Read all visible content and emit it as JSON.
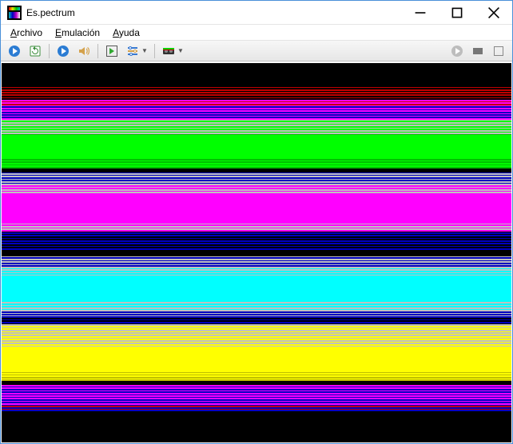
{
  "window": {
    "title": "Es.pectrum"
  },
  "menu": {
    "items": [
      {
        "accel": "A",
        "rest": "rchivo"
      },
      {
        "accel": "E",
        "rest": "mulación"
      },
      {
        "accel": "A",
        "rest": "yuda"
      }
    ]
  },
  "toolbar": {
    "icons_left": [
      "play-icon",
      "refresh-icon",
      "sep",
      "run-icon",
      "sound-icon",
      "sep",
      "step-icon",
      "config-icon",
      "sep",
      "tape-icon"
    ],
    "icons_right": [
      "record-icon",
      "screen-icon",
      "snapshot-icon"
    ]
  },
  "spectrum_colors": {
    "K": "#000000",
    "R": "#c00000",
    "B": "#0000c0",
    "M": "#c000c0",
    "G": "#00c000",
    "C": "#00c0c0",
    "Y": "#c0c000",
    "W": "#c0c0c0",
    "r": "#ff0000",
    "b": "#0000ff",
    "m": "#ff00ff",
    "g": "#00ff00",
    "c": "#00ffff",
    "y": "#ffff00",
    "w": "#ffffff"
  },
  "stripes": [
    "K",
    "K",
    "K",
    "K",
    "K",
    "K",
    "K",
    "K",
    "K",
    "K",
    "K",
    "K",
    "K",
    "K",
    "K",
    "K",
    "K",
    "K",
    "R",
    "K",
    "R",
    "K",
    "R",
    "K",
    "R",
    "K",
    "R",
    "K",
    "m",
    "R",
    "m",
    "R",
    "m",
    "B",
    "m",
    "B",
    "m",
    "B",
    "m",
    "B",
    "m",
    "B",
    "m",
    "W",
    "g",
    "W",
    "g",
    "W",
    "g",
    "W",
    "g",
    "W",
    "g",
    "W",
    "G",
    "g",
    "g",
    "g",
    "g",
    "g",
    "g",
    "g",
    "g",
    "g",
    "g",
    "g",
    "g",
    "g",
    "g",
    "g",
    "g",
    "g",
    "g",
    "G",
    "g",
    "G",
    "g",
    "G",
    "g",
    "G",
    "K",
    "K",
    "K",
    "B",
    "W",
    "B",
    "W",
    "B",
    "W",
    "B",
    "W",
    "B",
    "W",
    "m",
    "W",
    "m",
    "W",
    "m",
    "W",
    "m",
    "m",
    "m",
    "m",
    "m",
    "m",
    "m",
    "m",
    "m",
    "m",
    "m",
    "m",
    "m",
    "m",
    "m",
    "m",
    "m",
    "m",
    "m",
    "m",
    "m",
    "m",
    "m",
    "W",
    "m",
    "W",
    "m",
    "W",
    "m",
    "K",
    "B",
    "K",
    "B",
    "K",
    "B",
    "K",
    "B",
    "K",
    "B",
    "K",
    "B",
    "K",
    "B",
    "K",
    "K",
    "K",
    "K",
    "K",
    "W",
    "B",
    "W",
    "B",
    "W",
    "B",
    "W",
    "B",
    "W",
    "c",
    "W",
    "c",
    "W",
    "c",
    "W",
    "c",
    "c",
    "c",
    "c",
    "c",
    "c",
    "c",
    "c",
    "c",
    "c",
    "c",
    "c",
    "c",
    "c",
    "c",
    "c",
    "c",
    "c",
    "c",
    "c",
    "W",
    "c",
    "W",
    "c",
    "W",
    "c",
    "W",
    "B",
    "W",
    "B",
    "W",
    "B",
    "K",
    "B",
    "K",
    "B",
    "K",
    "W",
    "y",
    "W",
    "y",
    "W",
    "y",
    "W",
    "y",
    "W",
    "y",
    "W",
    "y",
    "W",
    "y",
    "W",
    "y",
    "W",
    "y",
    "y",
    "y",
    "y",
    "y",
    "y",
    "y",
    "y",
    "y",
    "y",
    "y",
    "y",
    "y",
    "y",
    "y",
    "y",
    "y",
    "y",
    "y",
    "Y",
    "y",
    "Y",
    "y",
    "Y",
    "y",
    "Y",
    "K",
    "K",
    "K",
    "m",
    "B",
    "m",
    "B",
    "m",
    "B",
    "m",
    "B",
    "m",
    "B",
    "m",
    "B",
    "m",
    "B",
    "m",
    "B",
    "R",
    "B",
    "R",
    "B",
    "K",
    "K",
    "K",
    "K",
    "K",
    "K",
    "K",
    "K",
    "K",
    "K",
    "K",
    "K",
    "K",
    "K",
    "K",
    "K",
    "K",
    "K",
    "K",
    "K",
    "K",
    "K",
    "K",
    "K",
    "K"
  ]
}
